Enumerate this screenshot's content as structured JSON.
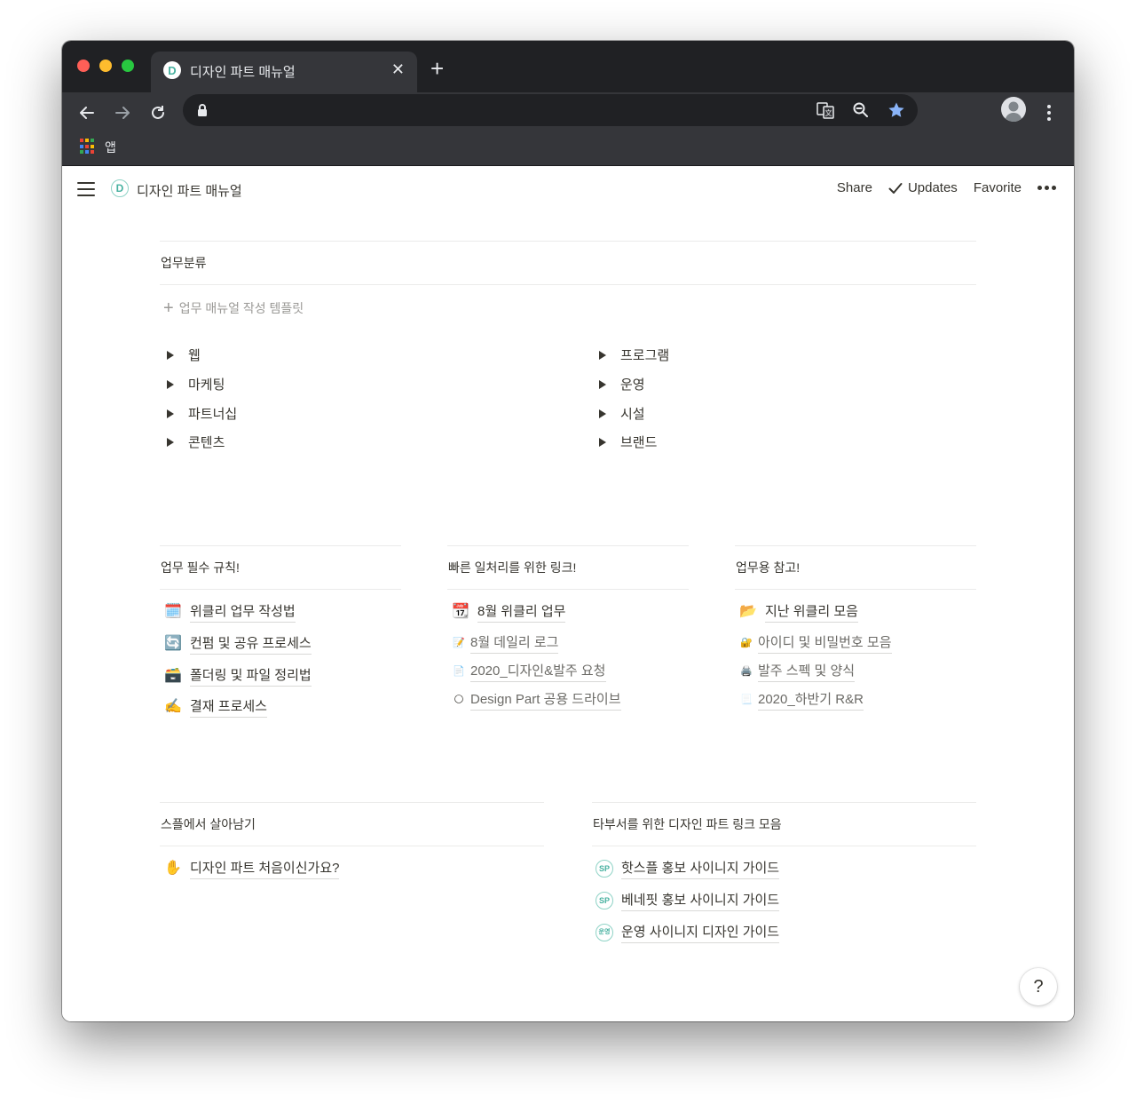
{
  "browser": {
    "tab_title": "디자인 파트 매뉴얼",
    "tab_favicon_letter": "D",
    "close_glyph": "✕",
    "newtab_glyph": "+",
    "bookmarks": {
      "apps_label": "앱"
    }
  },
  "notion": {
    "topbar": {
      "page_icon_letter": "D",
      "page_title": "디자인 파트 매뉴얼",
      "share": "Share",
      "updates": "Updates",
      "favorite": "Favorite"
    },
    "section_work": {
      "title": "업무분류",
      "template_plus": "+",
      "template_label": "업무 매뉴얼 작성 템플릿",
      "left_toggles": [
        "웹",
        "마케팅",
        "파트너십",
        "콘텐츠"
      ],
      "right_toggles": [
        "프로그램",
        "운영",
        "시설",
        "브랜드"
      ]
    },
    "col_rules": {
      "title": "업무 필수 규칙!",
      "items": [
        {
          "icon": "🗓️",
          "label": "위클리 업무 작성법"
        },
        {
          "icon": "🔄",
          "label": "컨펌 및 공유 프로세스"
        },
        {
          "icon": "🗃️",
          "label": "폴더링 및 파일 정리법"
        },
        {
          "icon": "✍️",
          "label": "결재 프로세스"
        }
      ]
    },
    "col_links": {
      "title": "빠른 일처리를 위한 링크!",
      "items": [
        {
          "icon": "📆",
          "label": "8월 위클리 업무"
        },
        {
          "icon": "📝",
          "label": "8월 데일리 로그"
        },
        {
          "icon": "📄",
          "label": "2020_디자인&발주 요청"
        },
        {
          "icon": "🌕",
          "label": "Design Part 공용 드라이브"
        }
      ]
    },
    "col_ref": {
      "title": "업무용 참고!",
      "items": [
        {
          "icon": "📂",
          "label": "지난 위클리 모음"
        },
        {
          "icon": "🔐",
          "label": "아이디 및 비밀번호 모음"
        },
        {
          "icon": "🖨️",
          "label": "발주 스펙 및 양식"
        },
        {
          "icon": "📃",
          "label": "2020_하반기  R&R"
        }
      ]
    },
    "col_survive": {
      "title": "스플에서 살아남기",
      "items": [
        {
          "icon": "✋",
          "label": "디자인 파트 처음이신가요?"
        }
      ]
    },
    "col_other": {
      "title": "타부서를 위한 디자인 파트 링크 모음",
      "items": [
        {
          "badge": "SP",
          "label": "핫스플 홍보 사이니지 가이드"
        },
        {
          "badge": "SP",
          "label": "베네핏 홍보 사이니지 가이드"
        },
        {
          "badge": "운영",
          "label": "운영 사이니지 디자인 가이드"
        }
      ]
    },
    "help": "?"
  }
}
